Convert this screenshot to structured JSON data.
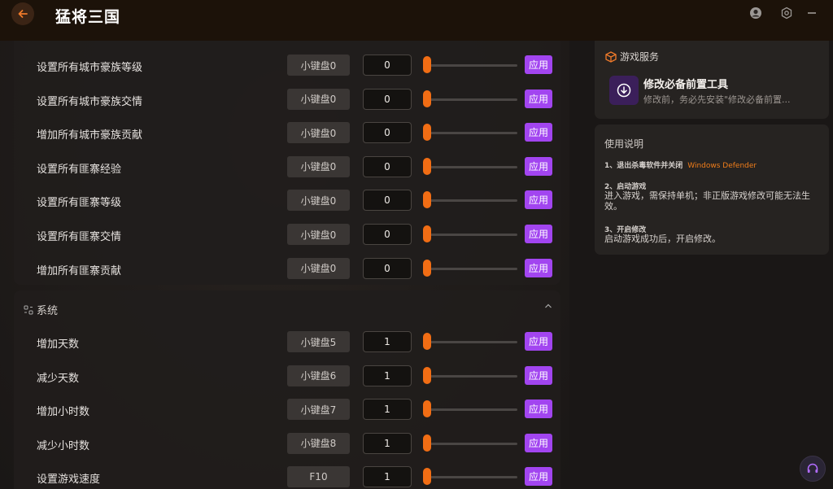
{
  "app": {
    "title": "猛将三国"
  },
  "window": {
    "controls": [
      "avatar-icon",
      "settings-icon",
      "minimize-icon"
    ]
  },
  "trainer": {
    "rows_top": [
      {
        "label": "设置所有城市豪族等级",
        "key": "小键盘0",
        "value": "0",
        "apply": "应用"
      },
      {
        "label": "设置所有城市豪族交情",
        "key": "小键盘0",
        "value": "0",
        "apply": "应用"
      },
      {
        "label": "增加所有城市豪族贡献",
        "key": "小键盘0",
        "value": "0",
        "apply": "应用"
      },
      {
        "label": "设置所有匪寨经验",
        "key": "小键盘0",
        "value": "0",
        "apply": "应用"
      },
      {
        "label": "设置所有匪寨等级",
        "key": "小键盘0",
        "value": "0",
        "apply": "应用"
      },
      {
        "label": "设置所有匪寨交情",
        "key": "小键盘0",
        "value": "0",
        "apply": "应用"
      },
      {
        "label": "增加所有匪寨贡献",
        "key": "小键盘0",
        "value": "0",
        "apply": "应用"
      }
    ],
    "system_section": {
      "title": "系统",
      "rows": [
        {
          "label": "增加天数",
          "key": "小键盘5",
          "value": "1",
          "apply": "应用"
        },
        {
          "label": "减少天数",
          "key": "小键盘6",
          "value": "1",
          "apply": "应用"
        },
        {
          "label": "增加小时数",
          "key": "小键盘7",
          "value": "1",
          "apply": "应用"
        },
        {
          "label": "减少小时数",
          "key": "小键盘8",
          "value": "1",
          "apply": "应用"
        },
        {
          "label": "设置游戏速度",
          "key": "F10",
          "value": "1",
          "apply": "应用"
        }
      ]
    }
  },
  "sidebar": {
    "service": {
      "title": "游戏服务",
      "tool_title": "修改必备前置工具",
      "tool_desc": "修改前，务必先安装\"修改必备前置..."
    },
    "help": {
      "title": "使用说明",
      "step1_title": "1、退出杀毒软件并关闭",
      "step1_highlight": "Windows Defender",
      "step2_title": "2、启动游戏",
      "step2_body": "进入游戏，需保持单机；非正版游戏修改可能无法生效。",
      "step3_title": "3、开启修改",
      "step3_body": "启动游戏成功后，开启修改。"
    }
  },
  "colors": {
    "accent": "#f16d14",
    "apply": "#a245f0",
    "panel": "#201d1c"
  }
}
